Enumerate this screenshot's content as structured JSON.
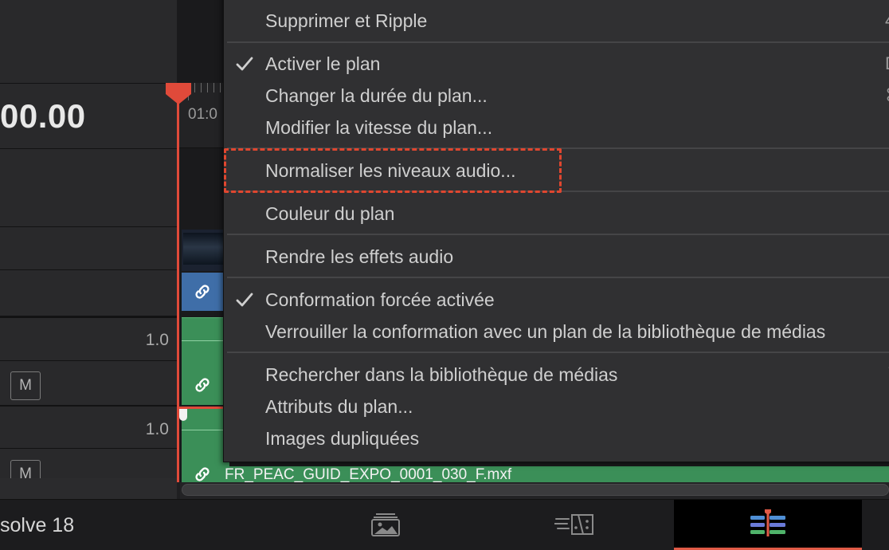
{
  "timeline": {
    "timecode": "00.00",
    "ruler_label": "01:0",
    "audio_track_1_gain": "1.0",
    "audio_track_2_gain": "1.0",
    "mute_label": "M",
    "audio_clip_name": "FR_PEAC_GUID_EXPO_0001_030_F.mxf"
  },
  "context_menu": {
    "items": [
      {
        "label": "Supprimer et Ripple",
        "checked": false
      },
      {
        "label": "Activer le plan",
        "checked": true
      },
      {
        "label": "Changer la durée du plan...",
        "checked": false
      },
      {
        "label": "Modifier la vitesse du plan...",
        "checked": false
      },
      {
        "label": "Normaliser les niveaux audio...",
        "checked": false,
        "highlighted": true
      },
      {
        "label": "Couleur du plan",
        "checked": false
      },
      {
        "label": "Rendre les effets audio",
        "checked": false
      },
      {
        "label": "Conformation forcée activée",
        "checked": true
      },
      {
        "label": "Verrouiller la conformation avec un plan de la bibliothèque de médias",
        "checked": false
      },
      {
        "label": "Rechercher dans la bibliothèque de médias",
        "checked": false
      },
      {
        "label": "Attributs du plan...",
        "checked": false
      },
      {
        "label": "Images dupliquées",
        "checked": false
      }
    ],
    "highlight_color": "#e0462f"
  },
  "bottom_bar": {
    "app_name": "solve 18",
    "pages": [
      {
        "icon": "media-page-icon",
        "active": false
      },
      {
        "icon": "cut-page-icon",
        "active": false
      },
      {
        "icon": "edit-page-icon",
        "active": true
      }
    ]
  },
  "colors": {
    "playhead": "#e04a3a",
    "audio_clip": "#3b8f58",
    "video_link": "#3f6ea8",
    "active_page_indicator": "#e05a46"
  }
}
